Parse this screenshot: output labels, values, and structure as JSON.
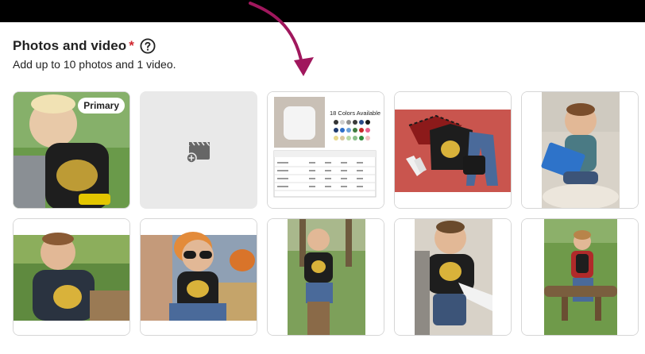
{
  "section": {
    "title": "Photos and video",
    "required_marker": "*",
    "subtitle": "Add up to 10 photos and 1 video."
  },
  "icons": {
    "help": "question-circle-icon",
    "add_media": "add-video-clapperboard-icon",
    "annotation": "curved-arrow-icon"
  },
  "colors": {
    "required": "#d0272f",
    "annotation_arrow": "#a0175d",
    "add_tile_bg": "#e9e9e9",
    "tile_border": "#d6d6d6"
  },
  "primary_badge": "Primary",
  "size_chart": {
    "colors_heading": "18 Colors Available"
  },
  "tiles": [
    {
      "type": "photo",
      "subject": "toddler-eating-ghoul-shirt"
    },
    {
      "type": "add-media"
    },
    {
      "type": "size-chart"
    },
    {
      "type": "photo",
      "subject": "flat-lay-flannel-shirt-jeans"
    },
    {
      "type": "photo",
      "subject": "toddler-with-book-on-rug"
    },
    {
      "type": "photo",
      "subject": "toddler-sitting-outdoors"
    },
    {
      "type": "photo",
      "subject": "toddler-sunglasses-pumpkins"
    },
    {
      "type": "photo",
      "subject": "toddler-on-tree-stump"
    },
    {
      "type": "photo",
      "subject": "toddler-lying-on-blanket"
    },
    {
      "type": "photo",
      "subject": "toddler-on-log-in-field"
    }
  ]
}
